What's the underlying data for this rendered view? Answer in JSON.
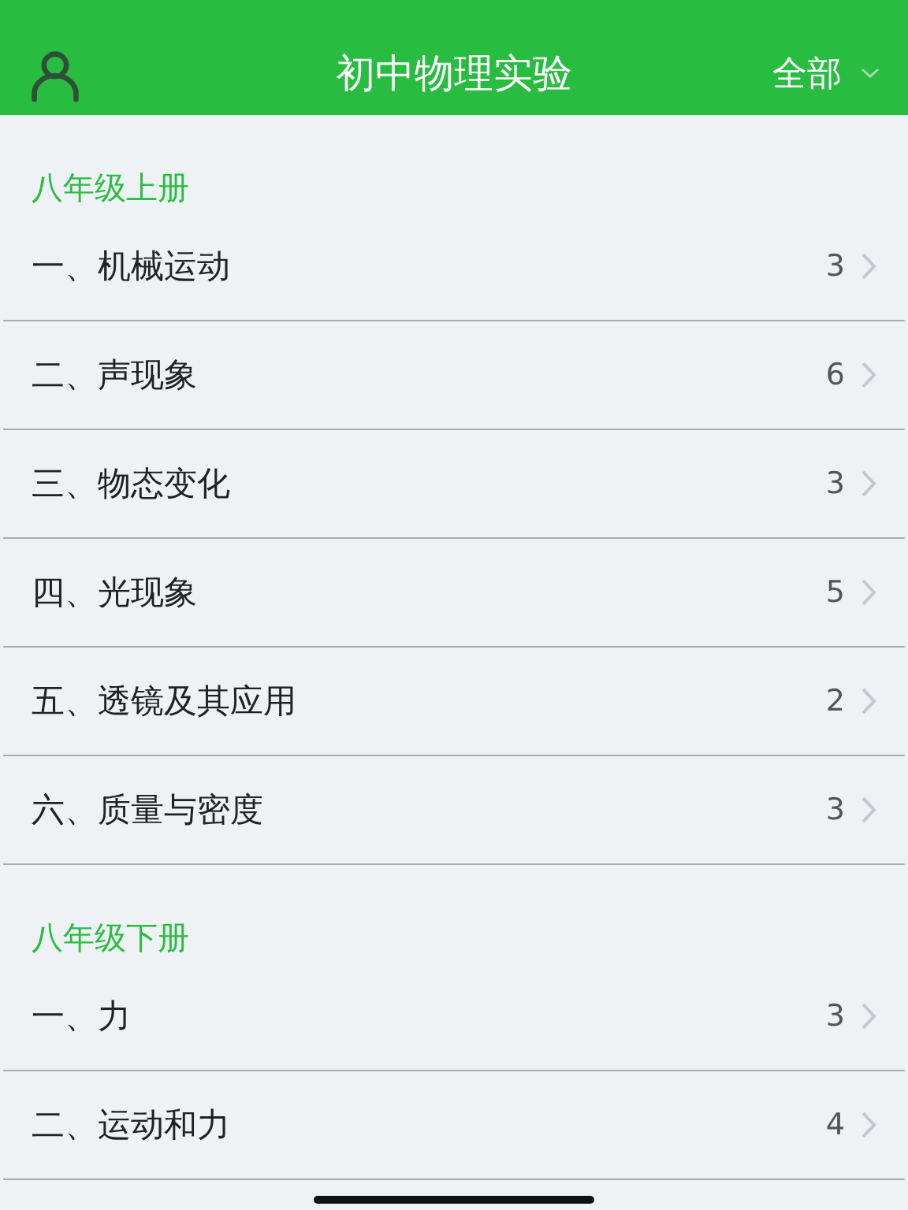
{
  "header": {
    "title": "初中物理实验",
    "filter": "全部"
  },
  "sections": [
    {
      "title": "八年级上册",
      "items": [
        {
          "label": "一、机械运动",
          "count": "3"
        },
        {
          "label": "二、声现象",
          "count": "6"
        },
        {
          "label": "三、物态变化",
          "count": "3"
        },
        {
          "label": "四、光现象",
          "count": "5"
        },
        {
          "label": "五、透镜及其应用",
          "count": "2"
        },
        {
          "label": "六、质量与密度",
          "count": "3"
        }
      ]
    },
    {
      "title": "八年级下册",
      "items": [
        {
          "label": "一、力",
          "count": "3"
        },
        {
          "label": "二、运动和力",
          "count": "4"
        }
      ]
    }
  ]
}
